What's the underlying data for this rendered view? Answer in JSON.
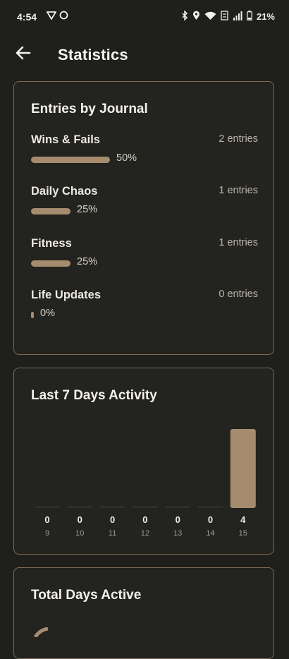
{
  "status_bar": {
    "time": "4:54",
    "battery": "21%",
    "left_icons": [
      "vpn-icon",
      "circle-icon"
    ],
    "right_icons": [
      "bluetooth-icon",
      "location-icon",
      "wifi-icon",
      "signal-icon",
      "battery-icon"
    ]
  },
  "app_bar": {
    "title": "Statistics",
    "back_icon": "arrow-back-icon"
  },
  "journals_card": {
    "title": "Entries by Journal",
    "accent": "#a68c6e",
    "items": [
      {
        "name": "Wins & Fails",
        "count": "2 entries",
        "percent_label": "50%",
        "percent": 50
      },
      {
        "name": "Daily Chaos",
        "count": "1 entries",
        "percent_label": "25%",
        "percent": 25
      },
      {
        "name": "Fitness",
        "count": "1 entries",
        "percent_label": "25%",
        "percent": 25
      },
      {
        "name": "Life Updates",
        "count": "0 entries",
        "percent_label": "0%",
        "percent": 0
      }
    ]
  },
  "activity_card": {
    "title": "Last 7 Days Activity"
  },
  "chart_data": {
    "type": "bar",
    "categories": [
      "9",
      "10",
      "11",
      "12",
      "13",
      "14",
      "15"
    ],
    "values": [
      0,
      0,
      0,
      0,
      0,
      0,
      4
    ],
    "value_labels": [
      "0",
      "0",
      "0",
      "0",
      "0",
      "0",
      "4"
    ],
    "title": "Last 7 Days Activity",
    "xlabel": "",
    "ylabel": "",
    "color": "#a68c6e",
    "grid": false
  },
  "total_days_card": {
    "title": "Total Days Active"
  },
  "colors": {
    "background": "#1f1f1b",
    "card_border": "#7e6a54",
    "accent": "#a68c6e"
  }
}
